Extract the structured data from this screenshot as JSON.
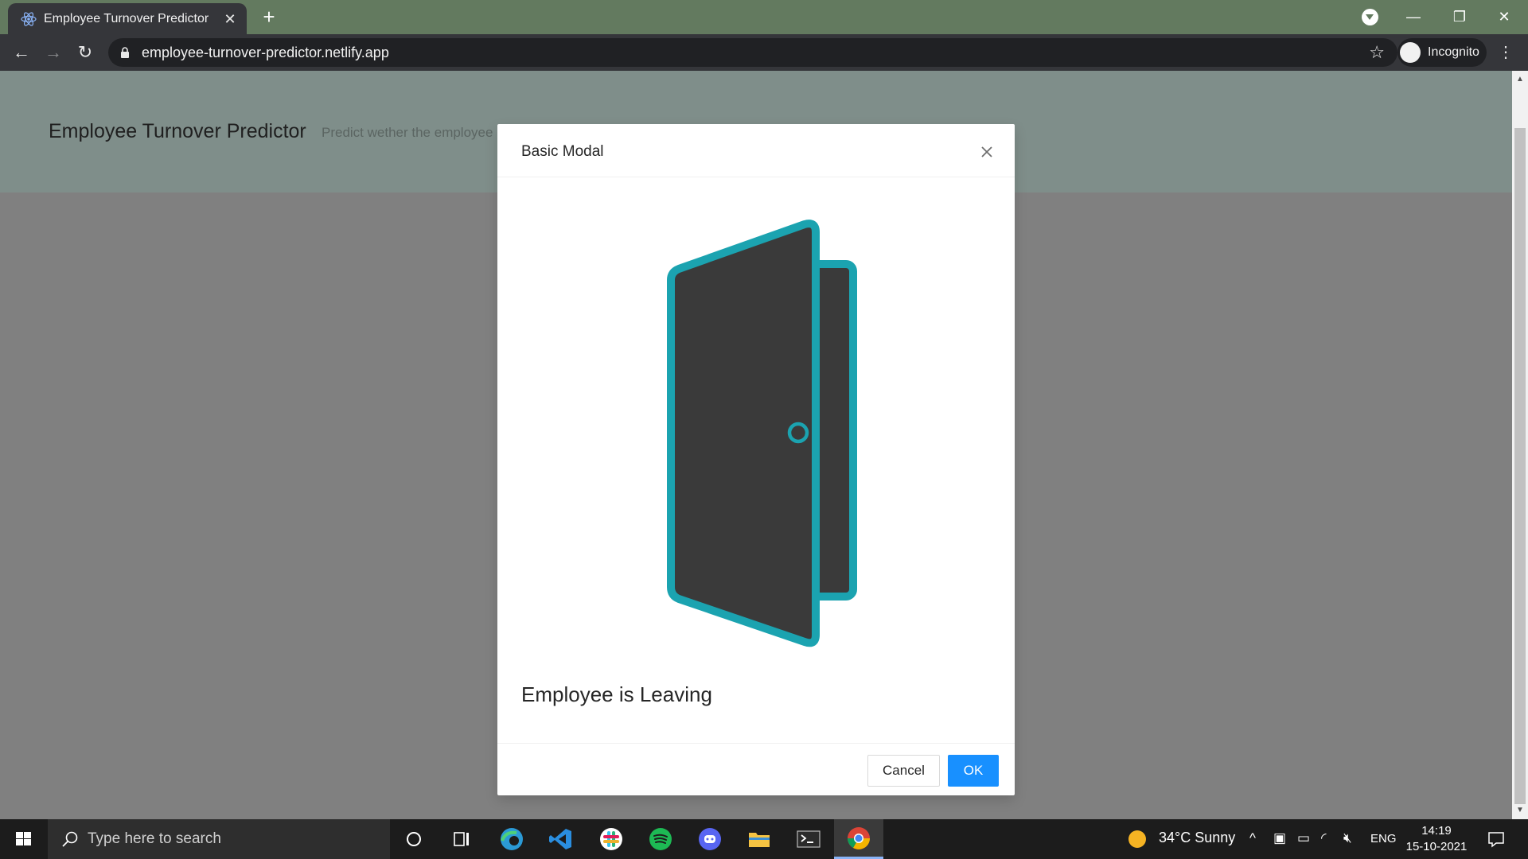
{
  "browser": {
    "tab_title": "Employee Turnover Predictor",
    "url": "employee-turnover-predictor.netlify.app",
    "profile_label": "Incognito"
  },
  "page": {
    "title": "Employee Turnover Predictor",
    "subtitle": "Predict wether the employee"
  },
  "modal": {
    "title": "Basic Modal",
    "result_text": "Employee is Leaving",
    "cancel_label": "Cancel",
    "ok_label": "OK",
    "door_color": "#1ba3b0",
    "door_fill": "#3a3a3a",
    "ok_color": "#1890ff"
  },
  "taskbar": {
    "search_placeholder": "Type here to search",
    "weather": "34°C  Sunny",
    "language": "ENG",
    "time": "14:19",
    "date": "15-10-2021"
  }
}
